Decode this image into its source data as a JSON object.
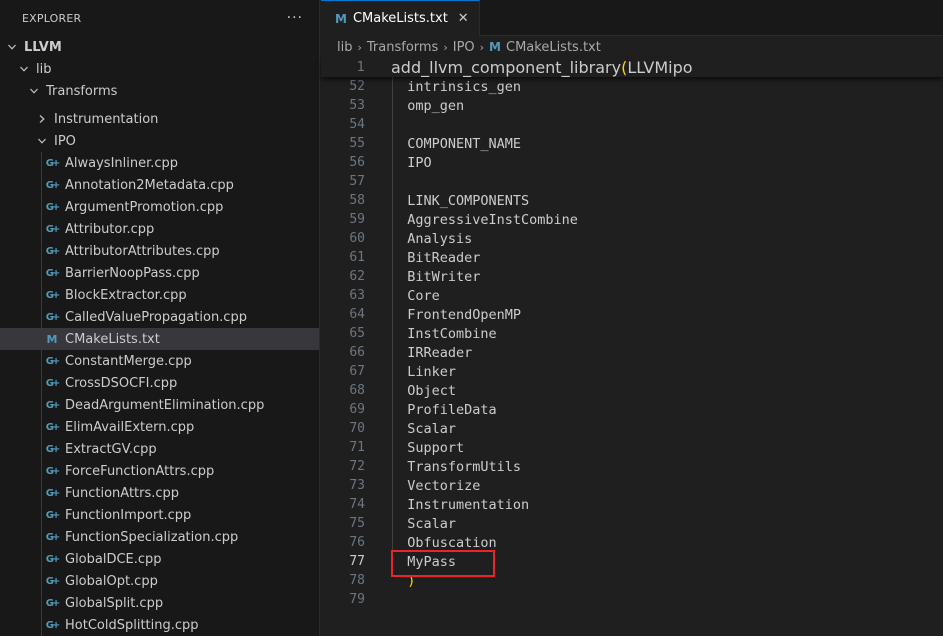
{
  "explorer": {
    "title": "EXPLORER",
    "more_label": "···",
    "root": "LLVM",
    "lib": "lib",
    "transforms": "Transforms",
    "instrumentation": "Instrumentation",
    "ipo": "IPO",
    "files": [
      {
        "name": "AlwaysInliner.cpp",
        "type": "cpp"
      },
      {
        "name": "Annotation2Metadata.cpp",
        "type": "cpp"
      },
      {
        "name": "ArgumentPromotion.cpp",
        "type": "cpp"
      },
      {
        "name": "Attributor.cpp",
        "type": "cpp"
      },
      {
        "name": "AttributorAttributes.cpp",
        "type": "cpp"
      },
      {
        "name": "BarrierNoopPass.cpp",
        "type": "cpp"
      },
      {
        "name": "BlockExtractor.cpp",
        "type": "cpp"
      },
      {
        "name": "CalledValuePropagation.cpp",
        "type": "cpp"
      },
      {
        "name": "CMakeLists.txt",
        "type": "cmake",
        "selected": true
      },
      {
        "name": "ConstantMerge.cpp",
        "type": "cpp"
      },
      {
        "name": "CrossDSOCFI.cpp",
        "type": "cpp"
      },
      {
        "name": "DeadArgumentElimination.cpp",
        "type": "cpp"
      },
      {
        "name": "ElimAvailExtern.cpp",
        "type": "cpp"
      },
      {
        "name": "ExtractGV.cpp",
        "type": "cpp"
      },
      {
        "name": "ForceFunctionAttrs.cpp",
        "type": "cpp"
      },
      {
        "name": "FunctionAttrs.cpp",
        "type": "cpp"
      },
      {
        "name": "FunctionImport.cpp",
        "type": "cpp"
      },
      {
        "name": "FunctionSpecialization.cpp",
        "type": "cpp"
      },
      {
        "name": "GlobalDCE.cpp",
        "type": "cpp"
      },
      {
        "name": "GlobalOpt.cpp",
        "type": "cpp"
      },
      {
        "name": "GlobalSplit.cpp",
        "type": "cpp"
      },
      {
        "name": "HotColdSplitting.cpp",
        "type": "cpp"
      }
    ]
  },
  "editor": {
    "tab_label": "CMakeLists.txt",
    "tab_icon": "M",
    "breadcrumb": [
      "lib",
      "Transforms",
      "IPO",
      "CMakeLists.txt"
    ],
    "sticky_line": {
      "num": "1",
      "text": "add_llvm_component_library",
      "paren": "(",
      "rest": "LLVMipo"
    },
    "lines": [
      {
        "num": "52",
        "text": "  intrinsics_gen"
      },
      {
        "num": "53",
        "text": "  omp_gen"
      },
      {
        "num": "54",
        "text": ""
      },
      {
        "num": "55",
        "text": "  COMPONENT_NAME"
      },
      {
        "num": "56",
        "text": "  IPO"
      },
      {
        "num": "57",
        "text": ""
      },
      {
        "num": "58",
        "text": "  LINK_COMPONENTS"
      },
      {
        "num": "59",
        "text": "  AggressiveInstCombine"
      },
      {
        "num": "60",
        "text": "  Analysis"
      },
      {
        "num": "61",
        "text": "  BitReader"
      },
      {
        "num": "62",
        "text": "  BitWriter"
      },
      {
        "num": "63",
        "text": "  Core"
      },
      {
        "num": "64",
        "text": "  FrontendOpenMP"
      },
      {
        "num": "65",
        "text": "  InstCombine"
      },
      {
        "num": "66",
        "text": "  IRReader"
      },
      {
        "num": "67",
        "text": "  Linker"
      },
      {
        "num": "68",
        "text": "  Object"
      },
      {
        "num": "69",
        "text": "  ProfileData"
      },
      {
        "num": "70",
        "text": "  Scalar"
      },
      {
        "num": "71",
        "text": "  Support"
      },
      {
        "num": "72",
        "text": "  TransformUtils"
      },
      {
        "num": "73",
        "text": "  Vectorize"
      },
      {
        "num": "74",
        "text": "  Instrumentation"
      },
      {
        "num": "75",
        "text": "  Scalar"
      },
      {
        "num": "76",
        "text": "  Obfuscation"
      },
      {
        "num": "77",
        "text": "  MyPass",
        "active": true
      },
      {
        "num": "78",
        "text": "  )"
      },
      {
        "num": "79",
        "text": ""
      }
    ]
  },
  "colors": {
    "accent": "#0078d4",
    "highlight_box": "#e8252a",
    "cmake_icon": "#519aba"
  }
}
